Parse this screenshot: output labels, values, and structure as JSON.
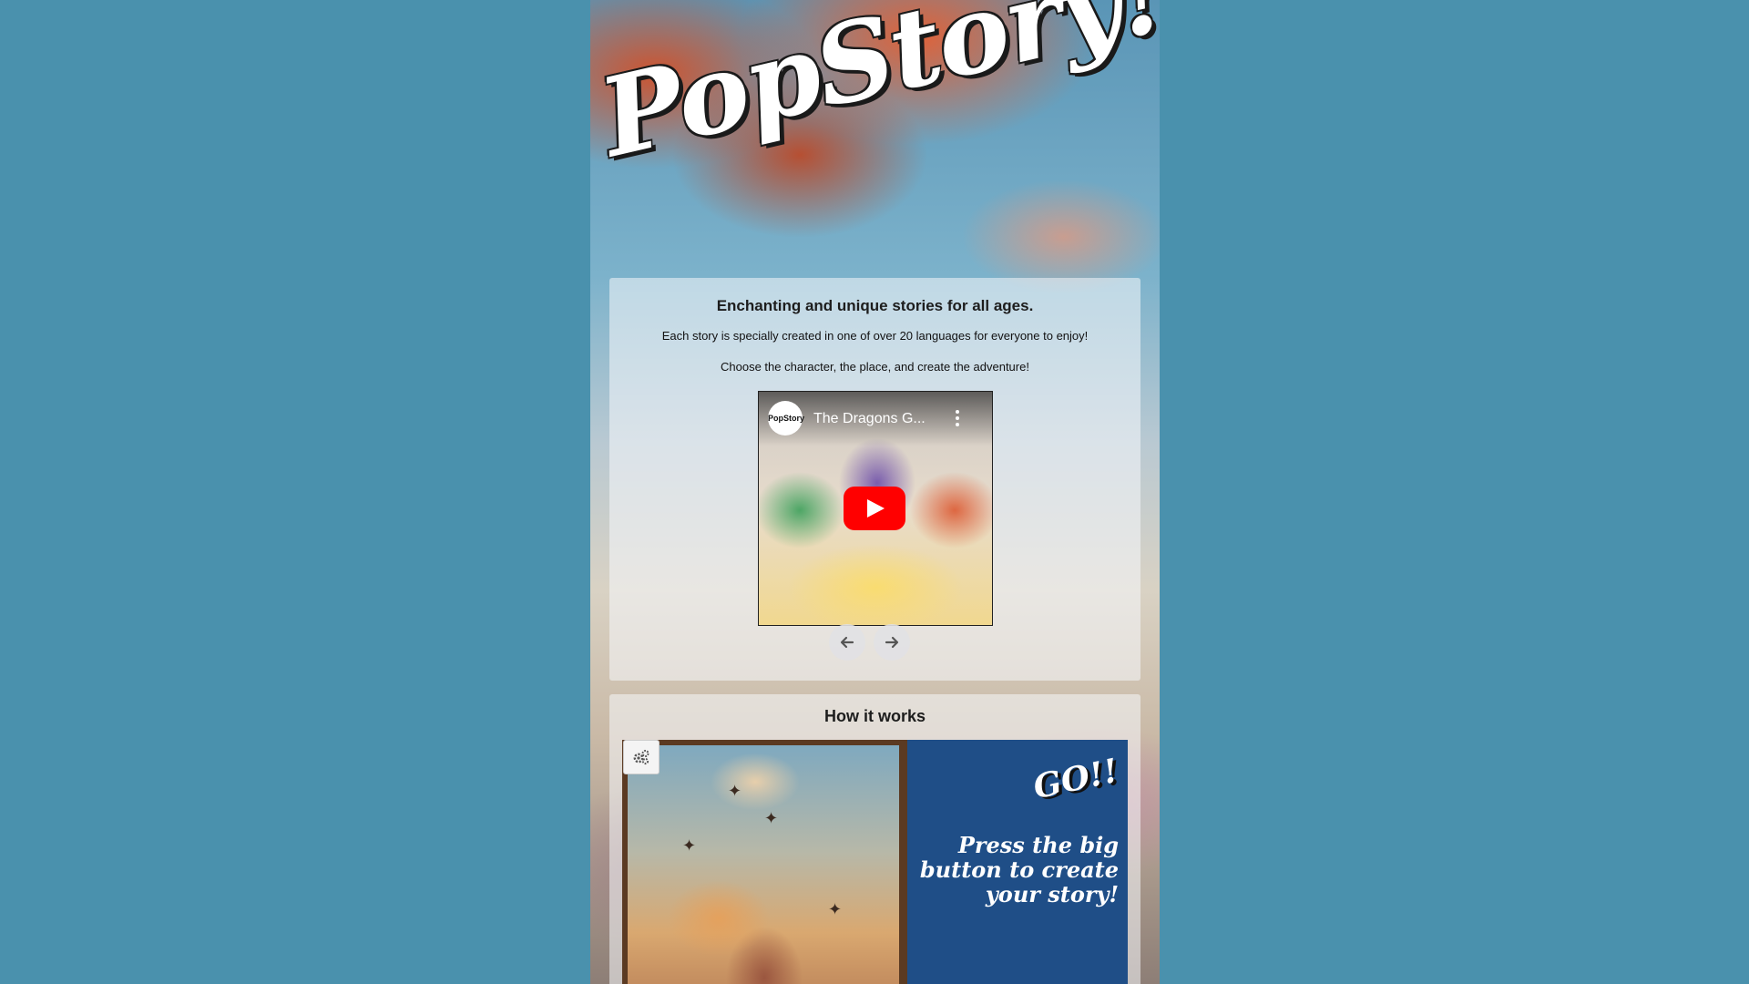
{
  "logo": {
    "text": "PopStory!!"
  },
  "intro": {
    "heading": "Enchanting and unique stories for all ages.",
    "line1": "Each story is specially created in one of over 20 languages for everyone to enjoy!",
    "line2": "Choose the character, the place, and create the adventure!"
  },
  "video": {
    "channel_avatar_text": "PopStory",
    "title": "The Dragons G...",
    "play_icon": "youtube-play-icon"
  },
  "carousel": {
    "prev_icon": "arrow-left-icon",
    "next_icon": "arrow-right-icon"
  },
  "how_it_works": {
    "heading": "How it works",
    "settings_icon": "gears-icon",
    "go_text": "GO!!",
    "instruction": "Press the big button to create your story!"
  },
  "colors": {
    "page_background": "#4a91ad",
    "panel_blue": "#1f4e87",
    "play_red": "#ff0000"
  }
}
